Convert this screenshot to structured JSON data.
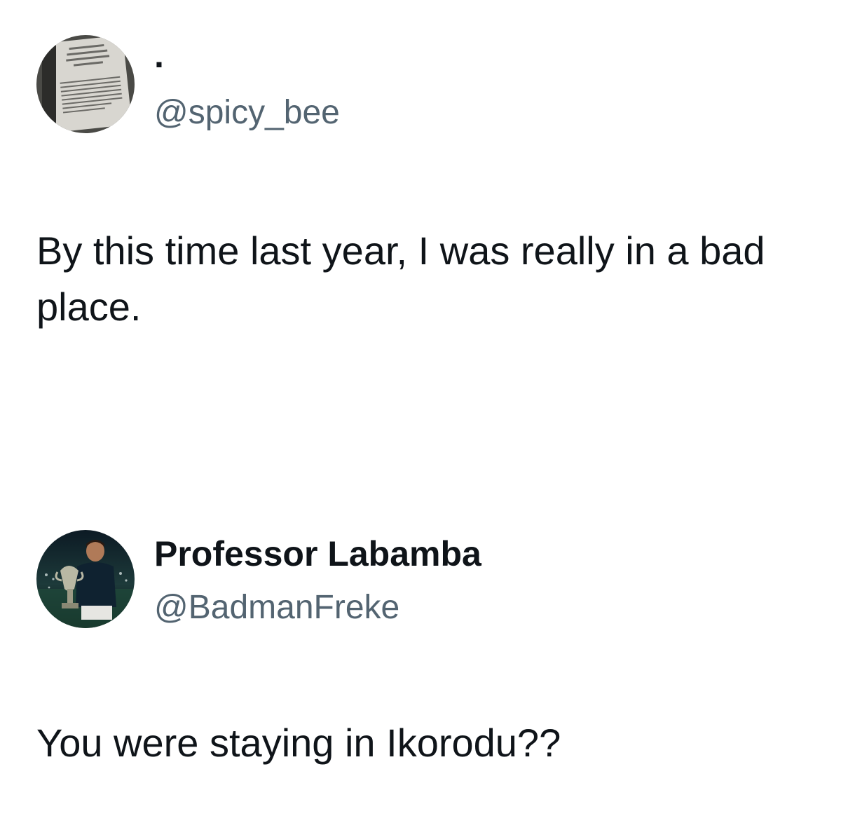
{
  "tweets": [
    {
      "display_name": "·",
      "handle": "@spicy_bee",
      "text": "By this time last year, I was really in a bad place."
    },
    {
      "display_name": "Professor Labamba",
      "handle": "@BadmanFreke",
      "text": "You were staying in Ikorodu??"
    }
  ]
}
